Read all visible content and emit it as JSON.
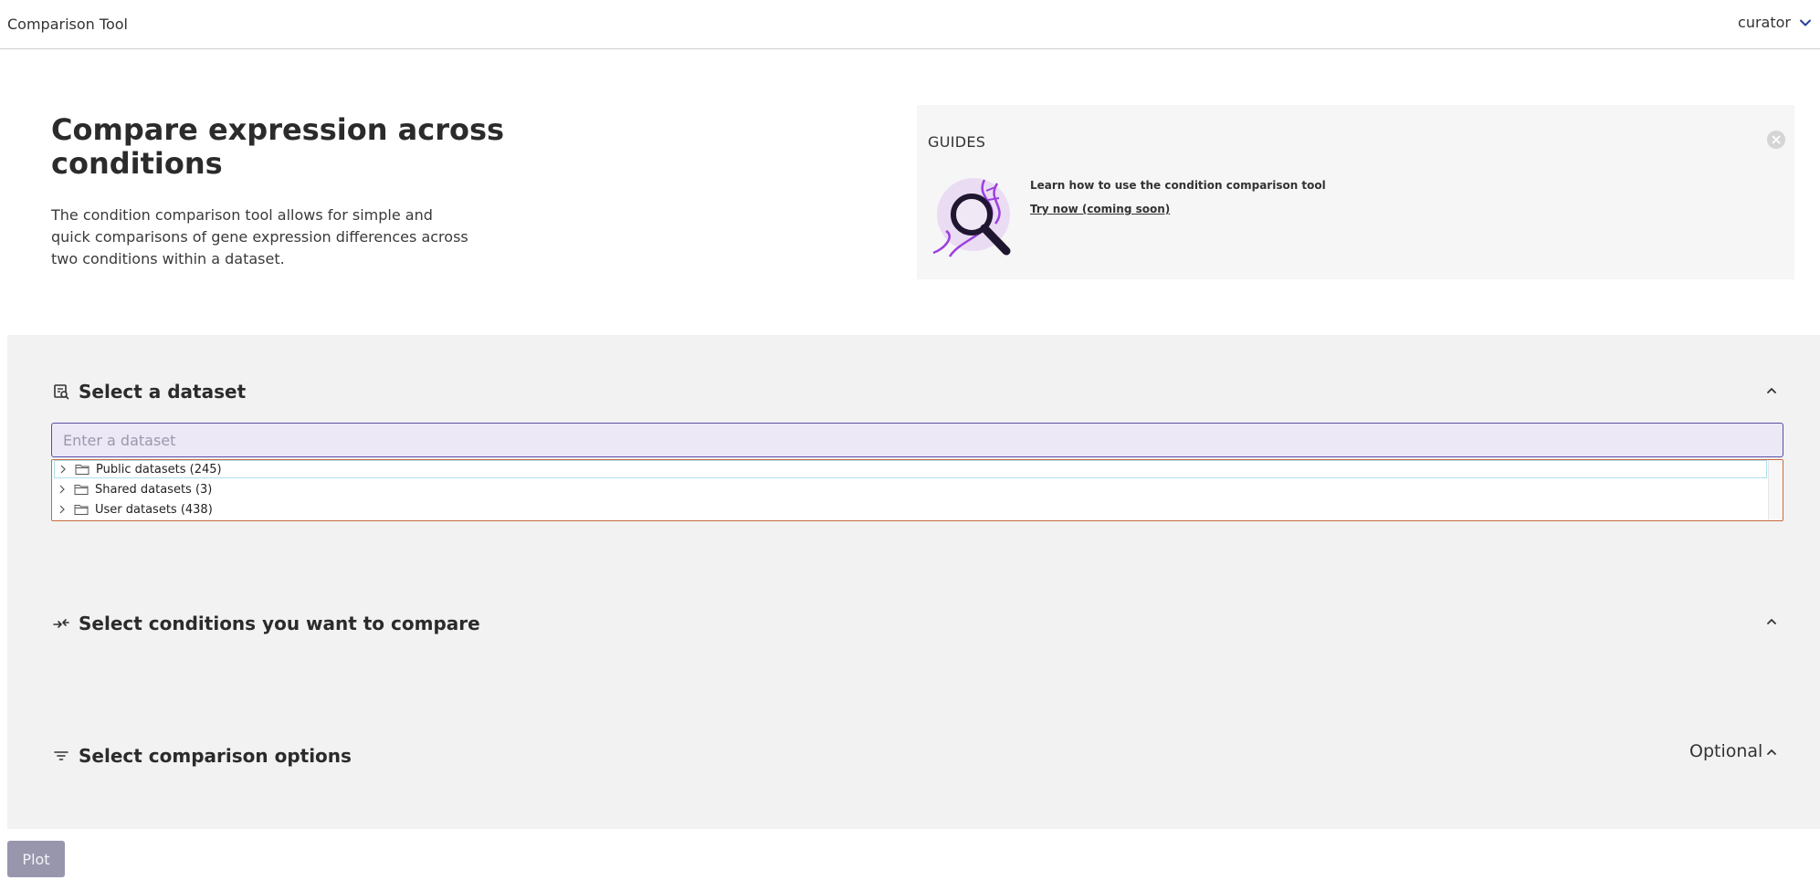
{
  "header": {
    "app_title": "Comparison Tool",
    "user_name": "curator",
    "user_icon": "chevron-down-icon"
  },
  "hero": {
    "title": "Compare expression across conditions",
    "description": "The condition comparison tool allows for simple and quick comparisons of gene expression differences across two conditions within a dataset."
  },
  "guides": {
    "title": "GUIDES",
    "text": "Learn how to use the condition comparison tool",
    "link": "Try now (coming soon)",
    "image_icon": "dna-magnifier-icon"
  },
  "sections": {
    "dataset": {
      "title": "Select a dataset",
      "icon": "dataset-search-icon",
      "input_placeholder": "Enter a dataset",
      "input_value": "",
      "tree": [
        {
          "label": "Public datasets (245)"
        },
        {
          "label": "Shared datasets (3)"
        },
        {
          "label": "User datasets (438)"
        }
      ]
    },
    "conditions": {
      "title": "Select conditions you want to compare",
      "icon": "compare-arrows-icon"
    },
    "options": {
      "title": "Select comparison options",
      "icon": "filter-icon",
      "optional_label": "Optional"
    }
  },
  "actions": {
    "plot_label": "Plot"
  },
  "colors": {
    "accent": "#5a4fa5",
    "input_bg": "#ece8f6",
    "tree_border": "#c96a3d",
    "plot_button": "#9896ad",
    "panel_bg": "#f2f2f2"
  }
}
